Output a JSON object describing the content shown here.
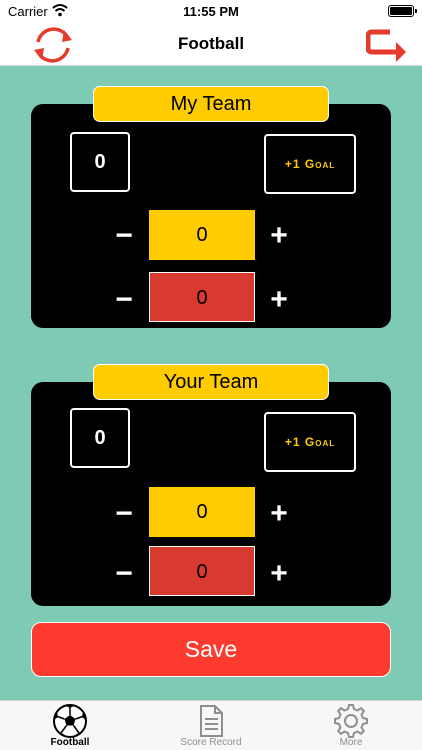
{
  "status_bar": {
    "carrier": "Carrier",
    "time": "11:55 PM"
  },
  "nav": {
    "title": "Football",
    "left_icon": "refresh-icon",
    "right_icon": "redo-arrow-icon"
  },
  "colors": {
    "accent_yellow": "#ffcc00",
    "accent_red": "#d93a2f",
    "save_red": "#ff3b30",
    "background": "#7ecab4"
  },
  "teams": [
    {
      "name": "My Team",
      "score": "0",
      "goal_label": "+1 Goal",
      "minus": "−",
      "plus": "+",
      "counter_yellow": "0",
      "counter_red": "0"
    },
    {
      "name": "Your Team",
      "score": "0",
      "goal_label": "+1 Goal",
      "minus": "−",
      "plus": "+",
      "counter_yellow": "0",
      "counter_red": "0"
    }
  ],
  "save_label": "Save",
  "tabs": [
    {
      "label": "Football",
      "icon": "soccer-ball-icon",
      "active": true
    },
    {
      "label": "Score Record",
      "icon": "document-icon",
      "active": false
    },
    {
      "label": "More",
      "icon": "gear-icon",
      "active": false
    }
  ]
}
